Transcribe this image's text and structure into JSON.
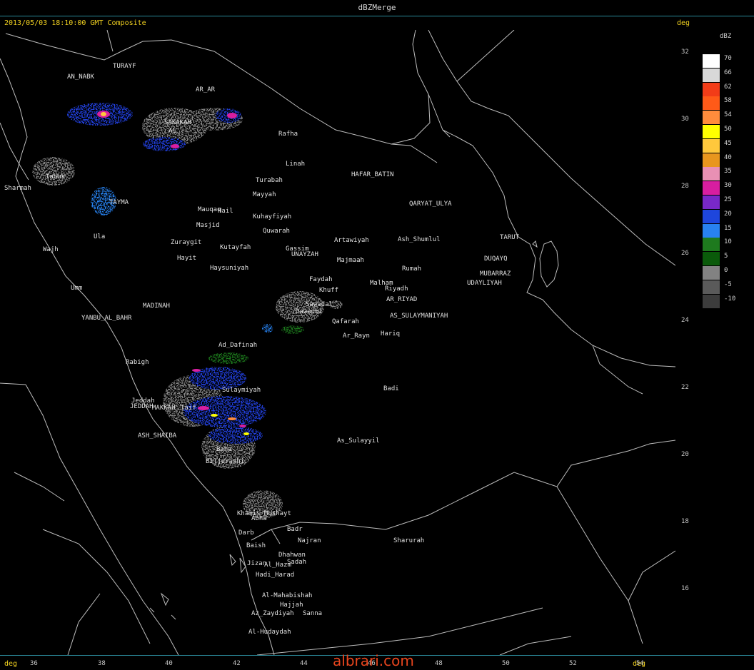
{
  "window": {
    "title": "dBZMerge"
  },
  "header": {
    "subtitle": "2013/05/03 18:10:00 GMT Composite",
    "unit": "deg"
  },
  "axes": {
    "bottom_unit": "deg",
    "bottom_unit_right": "deg",
    "x_ticks": [
      "36",
      "38",
      "40",
      "42",
      "44",
      "46",
      "48",
      "50",
      "52",
      "54"
    ],
    "y_ticks": [
      "32",
      "30",
      "28",
      "26",
      "24",
      "22",
      "20",
      "18",
      "16"
    ]
  },
  "legend": {
    "unit": "dBZ",
    "entries": [
      {
        "value": "70",
        "color": "#ffffff"
      },
      {
        "value": "66",
        "color": "#d8d8d8"
      },
      {
        "value": "62",
        "color": "#f23c18"
      },
      {
        "value": "58",
        "color": "#ff5a18"
      },
      {
        "value": "54",
        "color": "#ff8c3c"
      },
      {
        "value": "50",
        "color": "#ffff00"
      },
      {
        "value": "45",
        "color": "#ffc83c"
      },
      {
        "value": "40",
        "color": "#e8961e"
      },
      {
        "value": "35",
        "color": "#e890b4"
      },
      {
        "value": "30",
        "color": "#d81ea0"
      },
      {
        "value": "25",
        "color": "#7828c8"
      },
      {
        "value": "20",
        "color": "#1e46dc"
      },
      {
        "value": "15",
        "color": "#2882f0"
      },
      {
        "value": "10",
        "color": "#1e7a1e"
      },
      {
        "value": "5",
        "color": "#0a5a0a"
      },
      {
        "value": "0",
        "color": "#828282"
      },
      {
        "value": "-5",
        "color": "#5a5a5a"
      },
      {
        "value": "-10",
        "color": "#3c3c3c"
      }
    ]
  },
  "places": [
    {
      "name": "TURAYF"
    },
    {
      "name": "AN_NABK"
    },
    {
      "name": "AR_AR"
    },
    {
      "name": "SAKAKAH"
    },
    {
      "name": "Al"
    },
    {
      "name": "Rafha"
    },
    {
      "name": "Tabuk"
    },
    {
      "name": "Sharmah"
    },
    {
      "name": "TAYMA"
    },
    {
      "name": "Linah"
    },
    {
      "name": "HAFAR_BATIN"
    },
    {
      "name": "Turabah"
    },
    {
      "name": "Mayyah"
    },
    {
      "name": "QARYAT_ULYA"
    },
    {
      "name": "Mauqaq"
    },
    {
      "name": "Hail"
    },
    {
      "name": "Kuhayfiyah"
    },
    {
      "name": "Masjid"
    },
    {
      "name": "Quwarah"
    },
    {
      "name": "Ula"
    },
    {
      "name": "Zuraygit"
    },
    {
      "name": "Kutayfah"
    },
    {
      "name": "Gassim"
    },
    {
      "name": "Artawiyah"
    },
    {
      "name": "Ash_Shumlul"
    },
    {
      "name": "TARUT"
    },
    {
      "name": "Wajh"
    },
    {
      "name": "Hayit"
    },
    {
      "name": "UNAYZAH"
    },
    {
      "name": "Majmaah"
    },
    {
      "name": "DUQAYQ"
    },
    {
      "name": "Haysuniyah"
    },
    {
      "name": "Rumah"
    },
    {
      "name": "MUBARRAZ"
    },
    {
      "name": "Faydah"
    },
    {
      "name": "UDAYLIYAH"
    },
    {
      "name": "Malham"
    },
    {
      "name": "Umm"
    },
    {
      "name": "Khuff"
    },
    {
      "name": "Riyadh"
    },
    {
      "name": "AR_RIYAD"
    },
    {
      "name": "MADINAH"
    },
    {
      "name": "Sawadal"
    },
    {
      "name": "Dawadmi"
    },
    {
      "name": "YANBU_AL_BAHR"
    },
    {
      "name": "AS_SULAYMANIYAH"
    },
    {
      "name": "Qafarah"
    },
    {
      "name": "Hariq"
    },
    {
      "name": "Ar_Rayn"
    },
    {
      "name": "Ad_Dafinah"
    },
    {
      "name": "Rabigh"
    },
    {
      "name": "Badi"
    },
    {
      "name": "Sulaymiyah"
    },
    {
      "name": "Jeddah"
    },
    {
      "name": "JEDDAH"
    },
    {
      "name": "MAKKAH"
    },
    {
      "name": "Taif"
    },
    {
      "name": "ASH_SHAIBA"
    },
    {
      "name": "As_Sulayyil"
    },
    {
      "name": "Baha"
    },
    {
      "name": "Biljurashi"
    },
    {
      "name": "Khamis_Mushayt"
    },
    {
      "name": "Abha"
    },
    {
      "name": "Badr"
    },
    {
      "name": "Darb"
    },
    {
      "name": "Najran"
    },
    {
      "name": "Sharurah"
    },
    {
      "name": "Baish"
    },
    {
      "name": "Dhahwan"
    },
    {
      "name": "Sadah"
    },
    {
      "name": "Jizan"
    },
    {
      "name": "Al_Hazm"
    },
    {
      "name": "Hadi_Harad"
    },
    {
      "name": "Al-Mahabishah"
    },
    {
      "name": "Hajjah"
    },
    {
      "name": "Az_Zaydiyah"
    },
    {
      "name": "Sanna"
    },
    {
      "name": "Al-Hudaydah"
    }
  ],
  "watermark": "albrari.com"
}
